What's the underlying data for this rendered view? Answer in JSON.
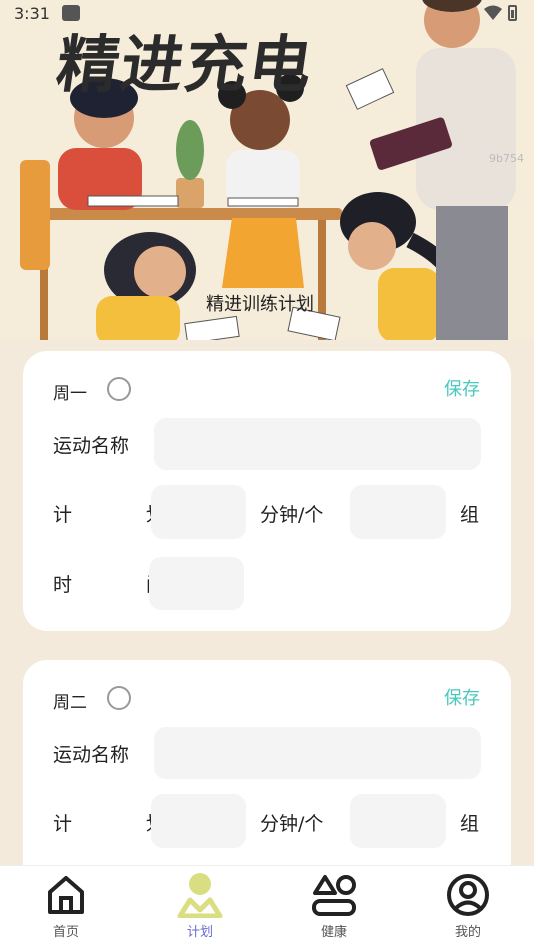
{
  "status_bar": {
    "time": "3:31"
  },
  "hero": {
    "title": "精进充电",
    "subtitle": "精进训练计划",
    "watermark": "9b754"
  },
  "cards": [
    {
      "day": "周一",
      "save_label": "保存",
      "exercise_label": "运动名称",
      "plan_label": "计 划",
      "unit_label": "分钟/个",
      "group_label": "组",
      "time_label": "时 间"
    },
    {
      "day": "周二",
      "save_label": "保存",
      "exercise_label": "运动名称",
      "plan_label": "计 划",
      "unit_label": "分钟/个",
      "group_label": "组"
    }
  ],
  "bottom_nav": {
    "items": [
      {
        "label": "首页",
        "icon": "home-icon"
      },
      {
        "label": "计划",
        "icon": "plan-icon",
        "active": true
      },
      {
        "label": "健康",
        "icon": "health-icon"
      },
      {
        "label": "我的",
        "icon": "profile-icon"
      }
    ]
  },
  "colors": {
    "accent": "#48c9bd",
    "active_nav": "#6b6bd0",
    "page_bg": "#f4eadb"
  }
}
